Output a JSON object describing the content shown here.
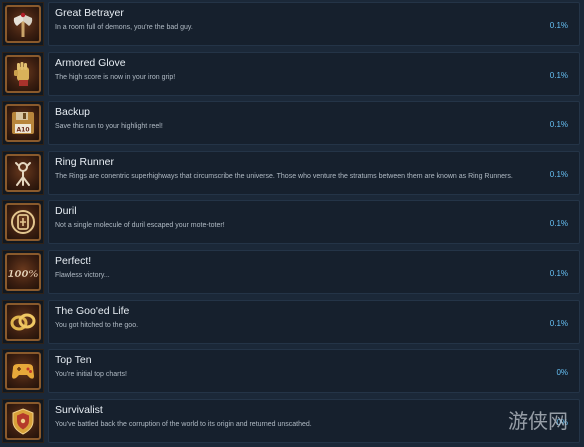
{
  "achievements": [
    {
      "icon": "axe-icon",
      "title": "Great Betrayer",
      "description": "In a room full of demons, you're the bad guy.",
      "percent": "0.1%"
    },
    {
      "icon": "glove-icon",
      "title": "Armored Glove",
      "description": "The high score is now in your iron grip!",
      "percent": "0.1%"
    },
    {
      "icon": "floppy-disk-icon",
      "title": "Backup",
      "description": "Save this run to your highlight reel!",
      "percent": "0.1%",
      "icon_text": "A10"
    },
    {
      "icon": "rune-icon",
      "title": "Ring Runner",
      "description": "The Rings are conentric superhighways that circumscribe the universe. Those who venture the stratums between them are known as Ring Runners.",
      "percent": "0.1%"
    },
    {
      "icon": "duril-icon",
      "title": "Duril",
      "description": "Not a single molecule of duril escaped your mote-toter!",
      "percent": "0.1%"
    },
    {
      "icon": "percent-badge-icon",
      "title": "Perfect!",
      "description": "Flawless victory...",
      "percent": "0.1%",
      "icon_text": "100%"
    },
    {
      "icon": "rings-icon",
      "title": "The Goo'ed Life",
      "description": "You got hitched to the goo.",
      "percent": "0.1%"
    },
    {
      "icon": "gamepad-icon",
      "title": "Top Ten",
      "description": "You're initial top charts!",
      "percent": "0%"
    },
    {
      "icon": "shield-icon",
      "title": "Survivalist",
      "description": "You've battled back the corruption of the world to its origin and returned unscathed.",
      "percent": "0%"
    }
  ],
  "watermark": {
    "icon": "watermark-logo-icon",
    "text": "游侠网"
  },
  "colors": {
    "background": "#1b2838",
    "panel": "#16202d",
    "percent": "#66c0f4",
    "title": "#e8eef4",
    "description": "#b0bac4",
    "icon_frame": "#8a5a2c"
  }
}
